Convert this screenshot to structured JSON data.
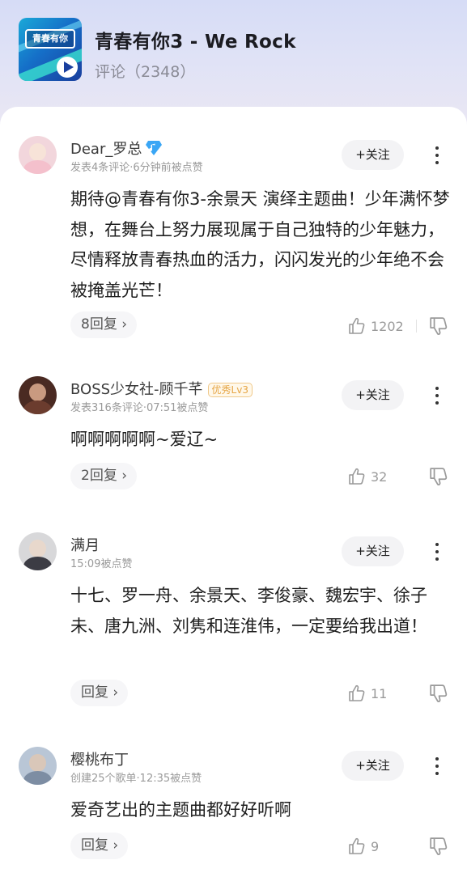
{
  "song": {
    "title": "青春有你3 - We Rock",
    "comment_count": "评论（2348）",
    "cover_text": "青春有你"
  },
  "comments": [
    {
      "username": "Dear_罗总",
      "meta": "发表4条评论·6分钟前被点赞",
      "follow_label": "+关注",
      "content": "期待@青春有你3-余景天 演绎主题曲！少年满怀梦想，在舞台上努力展现属于自己独特的少年魅力，尽情释放青春热血的活力，闪闪发光的少年绝不会被掩盖光芒！",
      "reply_label": "8回复 ›",
      "likes": "1202",
      "badge": "diamond-icon"
    },
    {
      "username": "BOSS少女社-顾千芊",
      "meta": "发表316条评论·07:51被点赞",
      "level_badge": "优秀Lv3",
      "follow_label": "+关注",
      "content": "啊啊啊啊啊~爱辽~",
      "reply_label": "2回复 ›",
      "likes": "32"
    },
    {
      "username": "满月",
      "meta": "15:09被点赞",
      "follow_label": "+关注",
      "content": "十七、罗一舟、余景天、李俊豪、魏宏宇、徐子未、唐九洲、刘隽和连淮伟，一定要给我出道！",
      "reply_label": "回复 ›",
      "likes": "11"
    },
    {
      "username": "樱桃布丁",
      "meta": "创建25个歌单·12:35被点赞",
      "follow_label": "+关注",
      "content": "爱奇艺出的主题曲都好好听啊",
      "reply_label": "回复 ›",
      "likes": "9"
    }
  ],
  "colors": {
    "header_bg": "#d6dcf6",
    "follow_bg": "#f3f3f5",
    "level_badge": "#e6a647",
    "diamond": "#3aa6f5"
  }
}
